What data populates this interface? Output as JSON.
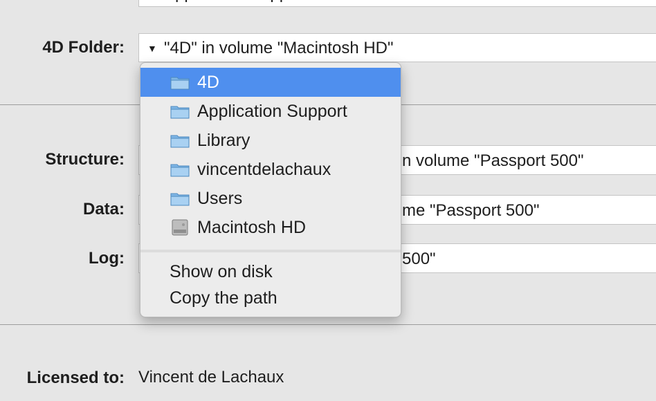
{
  "labels": {
    "folder": "4D Folder:",
    "structure": "Structure:",
    "data": "Data:",
    "log": "Log:",
    "licensed": "Licensed to:"
  },
  "fields": {
    "top_partial": "Application Support",
    "folder": "\"4D\" in volume \"Macintosh HD\"",
    "structure_partial": "n volume \"Passport 500\"",
    "data_partial": "me \"Passport 500\"",
    "log_partial": "500\"",
    "licensed_value": "Vincent de Lachaux"
  },
  "popup_menu": {
    "path_items": [
      {
        "label": "4D",
        "icon": "folder-icon",
        "selected": true
      },
      {
        "label": "Application Support",
        "icon": "folder-icon",
        "selected": false
      },
      {
        "label": "Library",
        "icon": "folder-icon",
        "selected": false
      },
      {
        "label": "vincentdelachaux",
        "icon": "folder-icon",
        "selected": false
      },
      {
        "label": "Users",
        "icon": "folder-icon",
        "selected": false
      },
      {
        "label": "Macintosh HD",
        "icon": "hard-drive-icon",
        "selected": false
      }
    ],
    "actions": [
      {
        "label": "Show on disk"
      },
      {
        "label": "Copy the path"
      }
    ]
  },
  "colors": {
    "selection": "#4f8fee",
    "window_bg": "#e6e6e6",
    "menu_bg": "#ececec"
  }
}
